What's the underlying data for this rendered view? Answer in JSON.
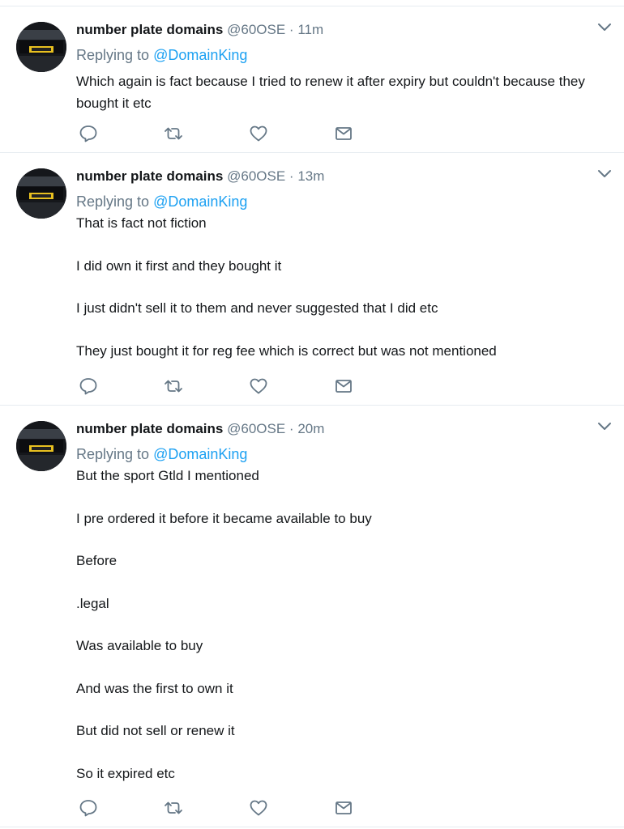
{
  "tweets": [
    {
      "author_name": "number plate domains",
      "handle": "@60OSE",
      "separator": "·",
      "time": "11m",
      "replying_prefix": "Replying to",
      "replying_to": "@DomainKing",
      "paragraphs": [
        "Which again is fact because I tried to renew it after expiry but couldn't because they bought it etc"
      ]
    },
    {
      "author_name": "number plate domains",
      "handle": "@60OSE",
      "separator": "·",
      "time": "13m",
      "replying_prefix": "Replying to",
      "replying_to": "@DomainKing",
      "paragraphs": [
        "That is fact not fiction",
        "I did own it first and they bought it",
        "I just didn't sell it to them and never suggested that I did etc",
        "They just bought it for reg fee which is correct but was not mentioned"
      ]
    },
    {
      "author_name": "number plate domains",
      "handle": "@60OSE",
      "separator": "·",
      "time": "20m",
      "replying_prefix": "Replying to",
      "replying_to": "@DomainKing",
      "paragraphs": [
        "But the sport Gtld I mentioned",
        "I pre ordered it before it became available to buy",
        "Before",
        ".legal",
        "Was available to buy",
        "And was the first to own it",
        "But did not sell or renew it",
        "So it expired etc"
      ]
    }
  ],
  "icons": {
    "reply": "reply-icon",
    "retweet": "retweet-icon",
    "like": "heart-icon",
    "message": "direct-message-icon",
    "more": "chevron-down-icon"
  },
  "colors": {
    "text": "#14171a",
    "secondary": "#657786",
    "link": "#1da1f2",
    "divider": "#e6ecf0"
  }
}
